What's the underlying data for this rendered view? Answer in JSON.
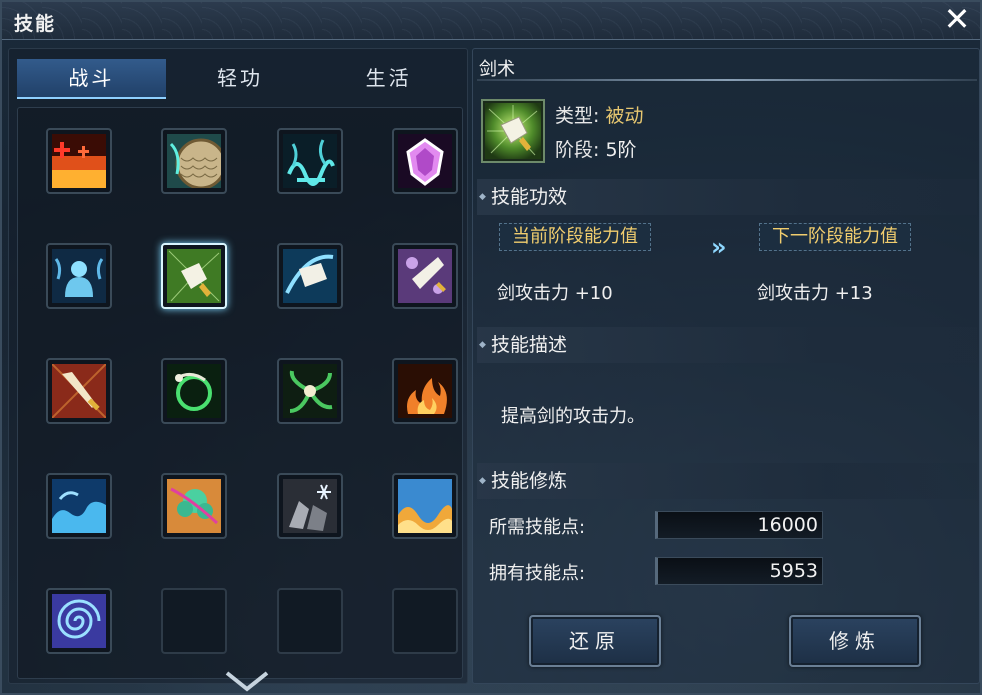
{
  "window": {
    "title": "技能",
    "close_symbol": "✕"
  },
  "tabs": [
    {
      "label": "战斗",
      "active": true
    },
    {
      "label": "轻功",
      "active": false
    },
    {
      "label": "生活",
      "active": false
    }
  ],
  "skills": [
    {
      "icon": "flame-field-icon"
    },
    {
      "icon": "shield-scales-icon"
    },
    {
      "icon": "spirit-bridge-icon"
    },
    {
      "icon": "pink-crystal-icon"
    },
    {
      "icon": "water-spirit-icon"
    },
    {
      "icon": "sword-art-icon",
      "selected": true
    },
    {
      "icon": "blade-whirl-icon"
    },
    {
      "icon": "purple-blade-icon"
    },
    {
      "icon": "gold-sword-icon"
    },
    {
      "icon": "green-orbit-icon"
    },
    {
      "icon": "wind-fan-icon"
    },
    {
      "icon": "fire-blossom-icon"
    },
    {
      "icon": "blue-wave-icon"
    },
    {
      "icon": "tree-pink-icon"
    },
    {
      "icon": "light-crystal-icon"
    },
    {
      "icon": "desert-wave-icon"
    },
    {
      "icon": "vortex-icon"
    },
    {
      "icon": "empty"
    },
    {
      "icon": "empty"
    },
    {
      "icon": "empty"
    }
  ],
  "detail": {
    "name": "剑术",
    "type_label": "类型:",
    "type_value": "被动",
    "stage_label": "阶段:",
    "stage_value": "5阶",
    "effect": {
      "header": "技能功效",
      "current_label": "当前阶段能力值",
      "next_label": "下一阶段能力值",
      "arrow": "»",
      "current_value": "剑攻击力 +10",
      "next_value": "剑攻击力 +13"
    },
    "description": {
      "header": "技能描述",
      "text": "提高剑的攻击力。"
    },
    "training": {
      "header": "技能修炼",
      "required_label": "所需技能点:",
      "required_value": "16000",
      "owned_label": "拥有技能点:",
      "owned_value": "5953"
    }
  },
  "buttons": {
    "restore": "还原",
    "train": "修炼"
  },
  "colors": {
    "accent_gold": "#e7c770",
    "tab_active": "#3c6eaa",
    "highlight": "#8fd8ff"
  }
}
